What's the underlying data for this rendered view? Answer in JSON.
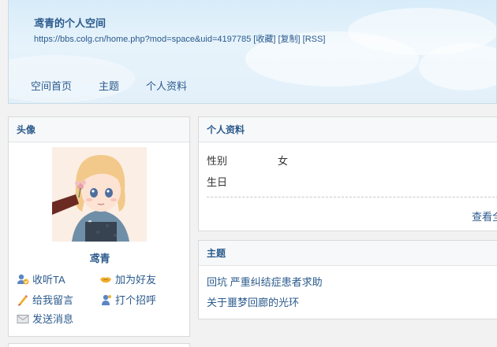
{
  "header": {
    "title": "鸢青的个人空间",
    "url": "https://bbs.colg.cn/home.php?mod=space&uid=4197785",
    "links": [
      "[收藏]",
      "[复制]",
      "[RSS]"
    ]
  },
  "nav": [
    "空间首页",
    "主题",
    "个人资料"
  ],
  "avatar_box": {
    "title": "头像",
    "username": "鸢青",
    "actions": [
      "收听TA",
      "加为好友",
      "给我留言",
      "打个招呼",
      "发送消息"
    ]
  },
  "profile": {
    "title": "个人资料",
    "fields": [
      {
        "label": "性别",
        "value": "女"
      },
      {
        "label": "生日",
        "value": ""
      }
    ],
    "view_all": "查看全"
  },
  "threads": {
    "title": "主题",
    "items": [
      "回坑 严重纠结症患者求助",
      "关于噩梦回廊的光环"
    ]
  },
  "colors": {
    "link": "#2a5a8c",
    "header_bg": "#dceef9",
    "border": "#d9d9d9"
  }
}
